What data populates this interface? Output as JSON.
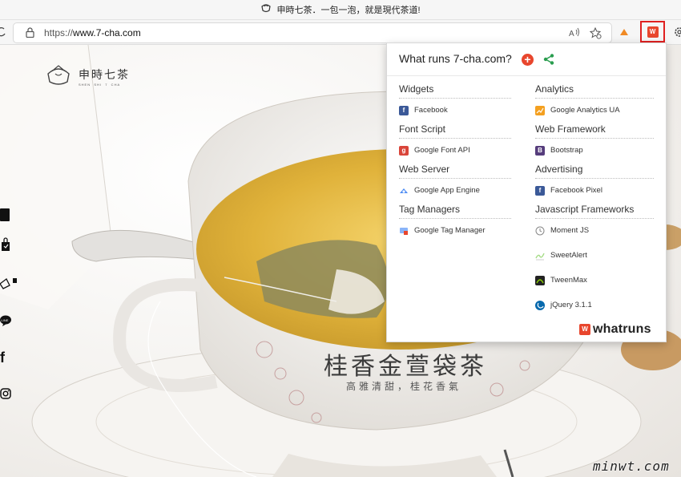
{
  "browser": {
    "window_title": "申時七茶．一包一泡，就是現代茶道!",
    "url_prefix": "https://",
    "url_host": "www.7-cha.com",
    "read_aloud_icon": "read-aloud-icon",
    "favorites_icon": "add-favorite-icon"
  },
  "site": {
    "logo_text": "申時七茶",
    "logo_sub": "SHEN  SHI  7  CHA",
    "hero_title": "桂香金萱袋茶",
    "hero_subtitle": "高雅清甜，桂花香氣",
    "social_icons": [
      "bag-icon",
      "shopping-bag-icon",
      "tea-icon",
      "line-icon",
      "facebook-icon",
      "instagram-icon"
    ]
  },
  "watermark": "minwt.com",
  "whatruns": {
    "title": "What runs 7-cha.com?",
    "brand": "whatruns",
    "accent": "#e8462d",
    "left_column": [
      {
        "category": "Widgets",
        "items": [
          {
            "label": "Facebook",
            "icon": "facebook",
            "color": "#3b5998"
          }
        ]
      },
      {
        "category": "Font Script",
        "items": [
          {
            "label": "Google Font API",
            "icon": "google-font",
            "color": "#d9453a"
          }
        ]
      },
      {
        "category": "Web Server",
        "items": [
          {
            "label": "Google App Engine",
            "icon": "app-engine",
            "color": "#4a8af4"
          }
        ]
      },
      {
        "category": "Tag Managers",
        "items": [
          {
            "label": "Google Tag Manager",
            "icon": "tag-manager",
            "color": "#8ab4f8"
          }
        ]
      }
    ],
    "right_column": [
      {
        "category": "Analytics",
        "items": [
          {
            "label": "Google Analytics UA",
            "icon": "analytics",
            "color": "#f4a020"
          }
        ]
      },
      {
        "category": "Web Framework",
        "items": [
          {
            "label": "Bootstrap",
            "icon": "bootstrap",
            "color": "#563d7c"
          }
        ]
      },
      {
        "category": "Advertising",
        "items": [
          {
            "label": "Facebook Pixel",
            "icon": "facebook",
            "color": "#3b5998"
          }
        ]
      },
      {
        "category": "Javascript Frameworks",
        "items": [
          {
            "label": "Moment JS",
            "icon": "clock",
            "color": "#888888"
          },
          {
            "label": "SweetAlert",
            "icon": "sweetalert",
            "color": "#a5dc86"
          },
          {
            "label": "TweenMax",
            "icon": "tweenmax",
            "color": "#222222"
          },
          {
            "label": "jQuery 3.1.1",
            "icon": "jquery",
            "color": "#0769ad"
          }
        ]
      }
    ]
  }
}
